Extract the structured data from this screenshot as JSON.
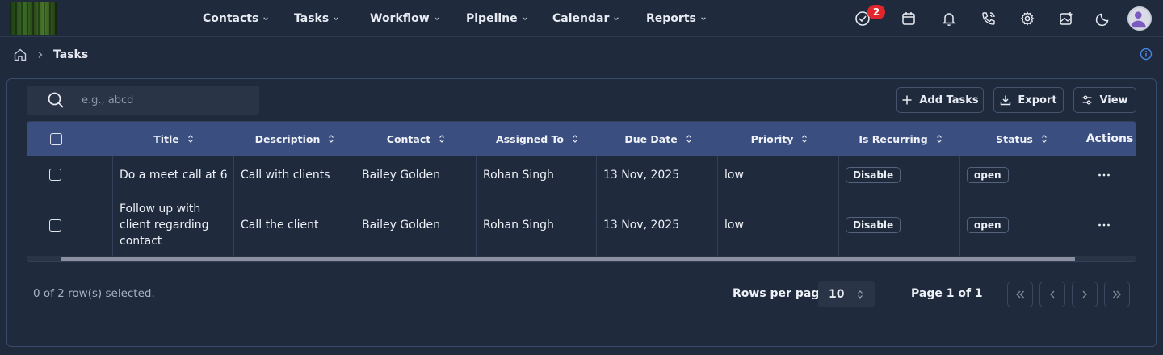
{
  "nav": {
    "menu": [
      {
        "label": "Contacts"
      },
      {
        "label": "Tasks"
      },
      {
        "label": "Workflow"
      },
      {
        "label": "Pipeline"
      },
      {
        "label": "Calendar"
      },
      {
        "label": "Reports"
      }
    ],
    "task_badge": "2"
  },
  "breadcrumb": {
    "current": "Tasks"
  },
  "search": {
    "placeholder": "e.g., abcd"
  },
  "toolbar": {
    "add_label": "Add Tasks",
    "export_label": "Export",
    "view_label": "View"
  },
  "table": {
    "columns": [
      "Title",
      "Description",
      "Contact",
      "Assigned To",
      "Due Date",
      "Priority",
      "Is Recurring",
      "Status",
      "Actions"
    ],
    "rows": [
      {
        "title": "Do a meet call at 6",
        "description": "Call with clients",
        "contact": "Bailey Golden",
        "assigned_to": "Rohan Singh",
        "due_date": "13 Nov, 2025",
        "priority": "low",
        "is_recurring": "Disable",
        "status": "open"
      },
      {
        "title": "Follow up with client regarding contact",
        "description": "Call the client",
        "contact": "Bailey Golden",
        "assigned_to": "Rohan Singh",
        "due_date": "13 Nov, 2025",
        "priority": "low",
        "is_recurring": "Disable",
        "status": "open"
      }
    ]
  },
  "footer": {
    "selection": "0 of 2 row(s) selected.",
    "rows_per_page_label": "Rows per page",
    "rows_per_page_value": "10",
    "page_label": "Page 1 of 1"
  },
  "colors": {
    "background": "#1f2a3d",
    "header": "#3a4f80",
    "badge": "#e0262b"
  }
}
